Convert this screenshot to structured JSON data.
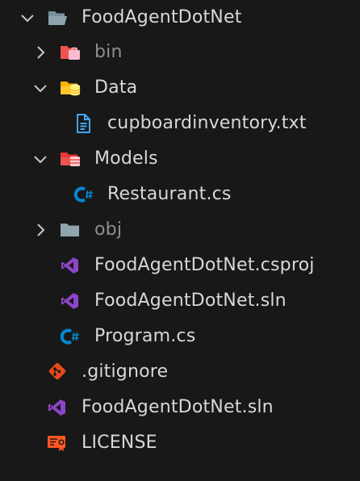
{
  "explorer": {
    "root": {
      "label": "FoodAgentDotNet",
      "icon": "folder-open-icon",
      "expanded": true
    },
    "items": [
      {
        "label": "bin",
        "icon": "folder-bin-icon",
        "expanded": false
      },
      {
        "label": "Data",
        "icon": "folder-database-icon",
        "expanded": true
      },
      {
        "label": "cupboardinventory.txt",
        "icon": "text-file-icon"
      },
      {
        "label": "Models",
        "icon": "folder-models-icon",
        "expanded": true
      },
      {
        "label": "Restaurant.cs",
        "icon": "csharp-file-icon"
      },
      {
        "label": "obj",
        "icon": "folder-icon",
        "expanded": false
      },
      {
        "label": "FoodAgentDotNet.csproj",
        "icon": "visual-studio-icon"
      },
      {
        "label": "FoodAgentDotNet.sln",
        "icon": "visual-studio-icon"
      },
      {
        "label": "Program.cs",
        "icon": "csharp-file-icon"
      },
      {
        "label": ".gitignore",
        "icon": "git-icon"
      },
      {
        "label": "FoodAgentDotNet.sln",
        "icon": "visual-studio-icon"
      },
      {
        "label": "LICENSE",
        "icon": "license-icon"
      }
    ]
  },
  "colors": {
    "background": "#181818",
    "text": "#d8d8d8",
    "ignored_text": "#8e8e8e",
    "folder_grey": "#90a4ae",
    "folder_red": "#ef5350",
    "folder_yellow": "#ffca28",
    "csharp_blue": "#0288d1",
    "visual_studio_purple": "#8e44c7",
    "git_orange": "#e64a19",
    "license_orange": "#ff5722",
    "text_file_blue": "#42a5f5"
  }
}
